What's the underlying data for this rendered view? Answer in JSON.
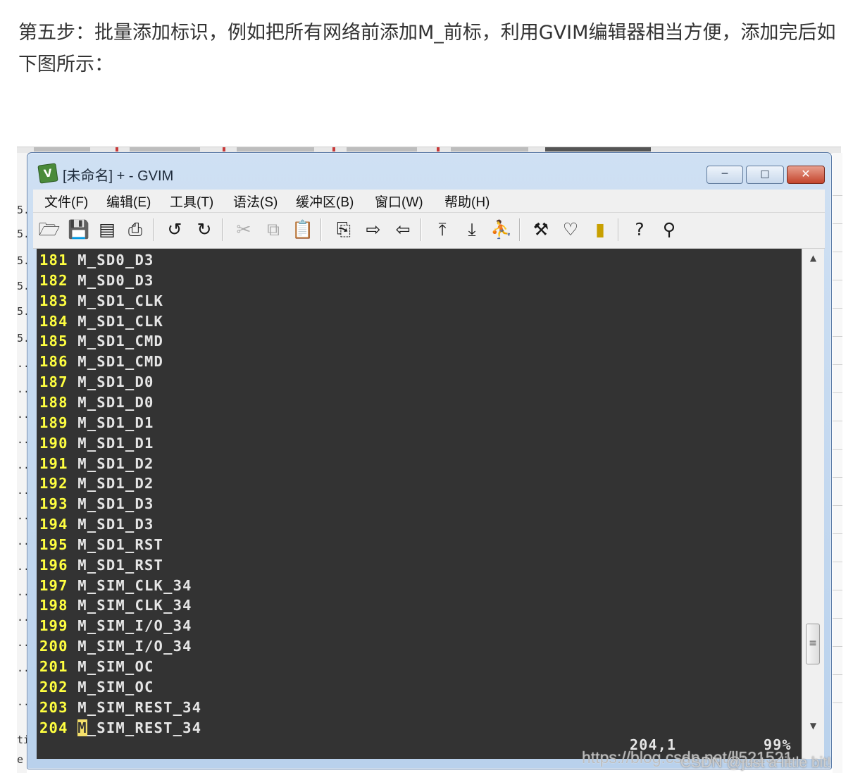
{
  "article": {
    "text": "第五步：批量添加标识，例如把所有网络前添加M_前标，利用GVIM编辑器相当方便，添加完后如下图所示："
  },
  "window": {
    "title": "[未命名] + - GVIM",
    "icon": "vim-icon",
    "controls": {
      "minimize": "minimize-icon",
      "maximize": "maximize-icon",
      "close": "close-icon"
    }
  },
  "menu": {
    "items": [
      {
        "label": "文件(F)"
      },
      {
        "label": "编辑(E)"
      },
      {
        "label": "工具(T)"
      },
      {
        "label": "语法(S)"
      },
      {
        "label": "缓冲区(B)"
      },
      {
        "label": "窗口(W)"
      },
      {
        "label": "帮助(H)"
      }
    ]
  },
  "toolbar": {
    "buttons": [
      "open-icon",
      "save-icon",
      "save-all-icon",
      "print-icon",
      "undo-icon",
      "redo-icon",
      "cut-icon",
      "copy-icon",
      "paste-icon",
      "find-replace-icon",
      "find-next-icon",
      "find-previous-icon",
      "load-session-icon",
      "save-session-icon",
      "run-script-icon",
      "make-icon",
      "build-tags-icon",
      "jump-tag-icon",
      "help-icon",
      "find-help-icon"
    ]
  },
  "editor": {
    "lines": [
      {
        "num": "181",
        "text": "M_SD0_D3"
      },
      {
        "num": "182",
        "text": "M_SD0_D3"
      },
      {
        "num": "183",
        "text": "M_SD1_CLK"
      },
      {
        "num": "184",
        "text": "M_SD1_CLK"
      },
      {
        "num": "185",
        "text": "M_SD1_CMD"
      },
      {
        "num": "186",
        "text": "M_SD1_CMD"
      },
      {
        "num": "187",
        "text": "M_SD1_D0"
      },
      {
        "num": "188",
        "text": "M_SD1_D0"
      },
      {
        "num": "189",
        "text": "M_SD1_D1"
      },
      {
        "num": "190",
        "text": "M_SD1_D1"
      },
      {
        "num": "191",
        "text": "M_SD1_D2"
      },
      {
        "num": "192",
        "text": "M_SD1_D2"
      },
      {
        "num": "193",
        "text": "M_SD1_D3"
      },
      {
        "num": "194",
        "text": "M_SD1_D3"
      },
      {
        "num": "195",
        "text": "M_SD1_RST"
      },
      {
        "num": "196",
        "text": "M_SD1_RST"
      },
      {
        "num": "197",
        "text": "M_SIM_CLK_34"
      },
      {
        "num": "198",
        "text": "M_SIM_CLK_34"
      },
      {
        "num": "199",
        "text": "M_SIM_I/O_34"
      },
      {
        "num": "200",
        "text": "M_SIM_I/O_34"
      },
      {
        "num": "201",
        "text": "M_SIM_OC"
      },
      {
        "num": "202",
        "text": "M_SIM_OC"
      },
      {
        "num": "203",
        "text": "M_SIM_REST_34"
      },
      {
        "num": "204",
        "text": "M_SIM_REST_34"
      }
    ],
    "cursor_char": "M",
    "cursor_rest": "_SIM_REST_34",
    "status_position": "204,1",
    "status_percent": "99%",
    "colors": {
      "background": "#333333",
      "line_number": "#ffff40",
      "text": "#e6e6e6",
      "cursor": "#f5e06a"
    }
  },
  "scrollbar": {
    "up": "scroll-up-arrow-icon",
    "down": "scroll-down-arrow-icon",
    "grip": "grip-icon"
  },
  "watermarks": {
    "url": "https://blog.csdn.net/ll521521",
    "author": "CSDN @just a little bit!"
  }
}
